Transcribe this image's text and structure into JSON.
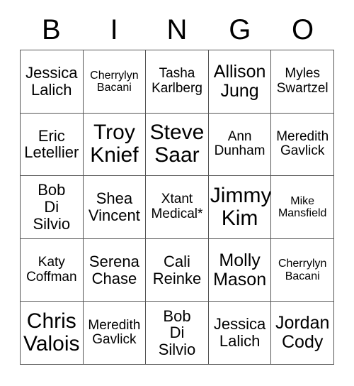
{
  "card": {
    "header": {
      "letters": [
        "B",
        "I",
        "N",
        "G",
        "O"
      ]
    },
    "grid": {
      "columns": 5,
      "rows": 5,
      "border_color": "#555555",
      "background_color": "#ffffff",
      "text_color": "#000000",
      "cells": [
        {
          "text": "Jessica\nLalich",
          "size": "md"
        },
        {
          "text": "Cherrylyn\nBacani",
          "size": "xs"
        },
        {
          "text": "Tasha\nKarlberg",
          "size": "sm"
        },
        {
          "text": "Allison\nJung",
          "size": "lg"
        },
        {
          "text": "Myles\nSwartzel",
          "size": "sm"
        },
        {
          "text": "Eric\nLetellier",
          "size": "md"
        },
        {
          "text": "Troy\nKnief",
          "size": "xl"
        },
        {
          "text": "Steve\nSaar",
          "size": "xl"
        },
        {
          "text": "Ann\nDunham",
          "size": "sm"
        },
        {
          "text": "Meredith\nGavlick",
          "size": "sm"
        },
        {
          "text": "Bob\nDi\nSilvio",
          "size": "md"
        },
        {
          "text": "Shea\nVincent",
          "size": "md"
        },
        {
          "text": "Xtant\nMedical*",
          "size": "sm"
        },
        {
          "text": "Jimmy\nKim",
          "size": "xl"
        },
        {
          "text": "Mike\nMansfield",
          "size": "xs"
        },
        {
          "text": "Katy\nCoffman",
          "size": "sm"
        },
        {
          "text": "Serena\nChase",
          "size": "md"
        },
        {
          "text": "Cali\nReinke",
          "size": "md"
        },
        {
          "text": "Molly\nMason",
          "size": "lg"
        },
        {
          "text": "Cherrylyn\nBacani",
          "size": "xs"
        },
        {
          "text": "Chris\nValois",
          "size": "xl"
        },
        {
          "text": "Meredith\nGavlick",
          "size": "sm"
        },
        {
          "text": "Bob\nDi\nSilvio",
          "size": "md"
        },
        {
          "text": "Jessica\nLalich",
          "size": "md"
        },
        {
          "text": "Jordan\nCody",
          "size": "lg"
        }
      ]
    }
  }
}
